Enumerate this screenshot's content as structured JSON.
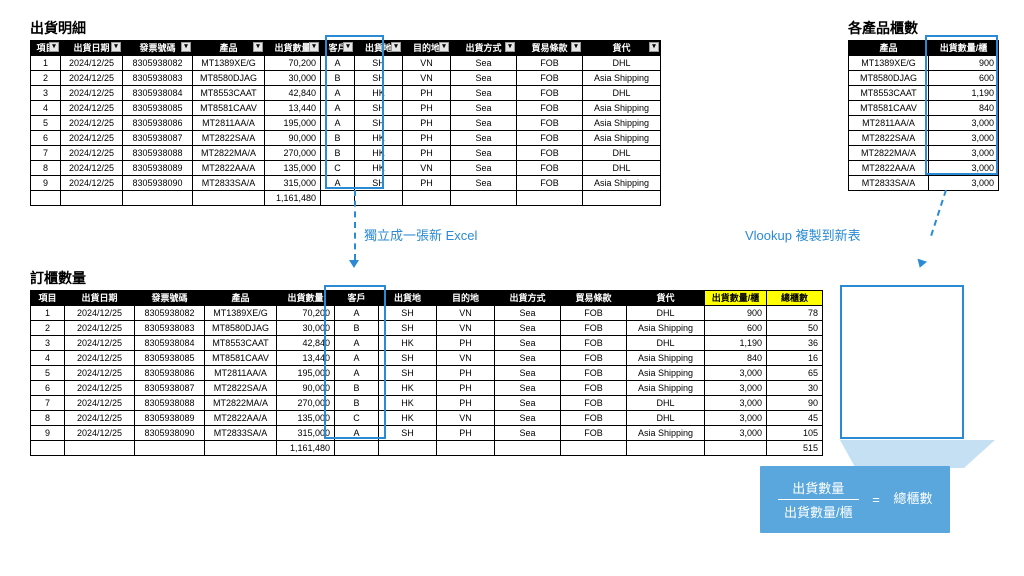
{
  "titles": {
    "detail": "出貨明細",
    "product_qty": "各產品櫃數",
    "order_qty": "訂櫃數量"
  },
  "detail_headers": {
    "idx": "項目",
    "date": "出貨日期",
    "inv": "發票號碼",
    "prod": "產品",
    "qty": "出貨數量",
    "cust": "客戶",
    "origin": "出貨地",
    "dest": "目的地",
    "mode": "出貨方式",
    "terms": "貿易條款",
    "forwarder": "貨代"
  },
  "product_headers": {
    "prod": "產品",
    "per": "出貨數量/櫃"
  },
  "order_headers": {
    "per": "出貨數量/櫃",
    "total": "總櫃數"
  },
  "detail_rows": [
    {
      "i": "1",
      "d": "2024/12/25",
      "inv": "8305938082",
      "p": "MT1389XE/G",
      "q": "70,200",
      "c": "A",
      "o": "SH",
      "de": "VN",
      "m": "Sea",
      "t": "FOB",
      "f": "DHL"
    },
    {
      "i": "2",
      "d": "2024/12/25",
      "inv": "8305938083",
      "p": "MT8580DJAG",
      "q": "30,000",
      "c": "B",
      "o": "SH",
      "de": "VN",
      "m": "Sea",
      "t": "FOB",
      "f": "Asia Shipping"
    },
    {
      "i": "3",
      "d": "2024/12/25",
      "inv": "8305938084",
      "p": "MT8553CAAT",
      "q": "42,840",
      "c": "A",
      "o": "HK",
      "de": "PH",
      "m": "Sea",
      "t": "FOB",
      "f": "DHL"
    },
    {
      "i": "4",
      "d": "2024/12/25",
      "inv": "8305938085",
      "p": "MT8581CAAV",
      "q": "13,440",
      "c": "A",
      "o": "SH",
      "de": "PH",
      "m": "Sea",
      "t": "FOB",
      "f": "Asia Shipping"
    },
    {
      "i": "5",
      "d": "2024/12/25",
      "inv": "8305938086",
      "p": "MT2811AA/A",
      "q": "195,000",
      "c": "A",
      "o": "SH",
      "de": "PH",
      "m": "Sea",
      "t": "FOB",
      "f": "Asia Shipping"
    },
    {
      "i": "6",
      "d": "2024/12/25",
      "inv": "8305938087",
      "p": "MT2822SA/A",
      "q": "90,000",
      "c": "B",
      "o": "HK",
      "de": "PH",
      "m": "Sea",
      "t": "FOB",
      "f": "Asia Shipping"
    },
    {
      "i": "7",
      "d": "2024/12/25",
      "inv": "8305938088",
      "p": "MT2822MA/A",
      "q": "270,000",
      "c": "B",
      "o": "HK",
      "de": "PH",
      "m": "Sea",
      "t": "FOB",
      "f": "DHL"
    },
    {
      "i": "8",
      "d": "2024/12/25",
      "inv": "8305938089",
      "p": "MT2822AA/A",
      "q": "135,000",
      "c": "C",
      "o": "HK",
      "de": "VN",
      "m": "Sea",
      "t": "FOB",
      "f": "DHL"
    },
    {
      "i": "9",
      "d": "2024/12/25",
      "inv": "8305938090",
      "p": "MT2833SA/A",
      "q": "315,000",
      "c": "A",
      "o": "SH",
      "de": "PH",
      "m": "Sea",
      "t": "FOB",
      "f": "Asia Shipping"
    }
  ],
  "detail_total": "1,161,480",
  "product_rows": [
    {
      "p": "MT1389XE/G",
      "v": "900"
    },
    {
      "p": "MT8580DJAG",
      "v": "600"
    },
    {
      "p": "MT8553CAAT",
      "v": "1,190"
    },
    {
      "p": "MT8581CAAV",
      "v": "840"
    },
    {
      "p": "MT2811AA/A",
      "v": "3,000"
    },
    {
      "p": "MT2822SA/A",
      "v": "3,000"
    },
    {
      "p": "MT2822MA/A",
      "v": "3,000"
    },
    {
      "p": "MT2822AA/A",
      "v": "3,000"
    },
    {
      "p": "MT2833SA/A",
      "v": "3,000"
    }
  ],
  "order_rows": [
    {
      "i": "1",
      "d": "2024/12/25",
      "inv": "8305938082",
      "p": "MT1389XE/G",
      "q": "70,200",
      "c": "A",
      "o": "SH",
      "de": "VN",
      "m": "Sea",
      "t": "FOB",
      "f": "DHL",
      "per": "900",
      "tot": "78"
    },
    {
      "i": "2",
      "d": "2024/12/25",
      "inv": "8305938083",
      "p": "MT8580DJAG",
      "q": "30,000",
      "c": "B",
      "o": "SH",
      "de": "VN",
      "m": "Sea",
      "t": "FOB",
      "f": "Asia Shipping",
      "per": "600",
      "tot": "50"
    },
    {
      "i": "3",
      "d": "2024/12/25",
      "inv": "8305938084",
      "p": "MT8553CAAT",
      "q": "42,840",
      "c": "A",
      "o": "HK",
      "de": "PH",
      "m": "Sea",
      "t": "FOB",
      "f": "DHL",
      "per": "1,190",
      "tot": "36"
    },
    {
      "i": "4",
      "d": "2024/12/25",
      "inv": "8305938085",
      "p": "MT8581CAAV",
      "q": "13,440",
      "c": "A",
      "o": "SH",
      "de": "VN",
      "m": "Sea",
      "t": "FOB",
      "f": "Asia Shipping",
      "per": "840",
      "tot": "16"
    },
    {
      "i": "5",
      "d": "2024/12/25",
      "inv": "8305938086",
      "p": "MT2811AA/A",
      "q": "195,000",
      "c": "A",
      "o": "SH",
      "de": "PH",
      "m": "Sea",
      "t": "FOB",
      "f": "Asia Shipping",
      "per": "3,000",
      "tot": "65"
    },
    {
      "i": "6",
      "d": "2024/12/25",
      "inv": "8305938087",
      "p": "MT2822SA/A",
      "q": "90,000",
      "c": "B",
      "o": "HK",
      "de": "PH",
      "m": "Sea",
      "t": "FOB",
      "f": "Asia Shipping",
      "per": "3,000",
      "tot": "30"
    },
    {
      "i": "7",
      "d": "2024/12/25",
      "inv": "8305938088",
      "p": "MT2822MA/A",
      "q": "270,000",
      "c": "B",
      "o": "HK",
      "de": "PH",
      "m": "Sea",
      "t": "FOB",
      "f": "DHL",
      "per": "3,000",
      "tot": "90"
    },
    {
      "i": "8",
      "d": "2024/12/25",
      "inv": "8305938089",
      "p": "MT2822AA/A",
      "q": "135,000",
      "c": "C",
      "o": "HK",
      "de": "VN",
      "m": "Sea",
      "t": "FOB",
      "f": "DHL",
      "per": "3,000",
      "tot": "45"
    },
    {
      "i": "9",
      "d": "2024/12/25",
      "inv": "8305938090",
      "p": "MT2833SA/A",
      "q": "315,000",
      "c": "A",
      "o": "SH",
      "de": "PH",
      "m": "Sea",
      "t": "FOB",
      "f": "Asia Shipping",
      "per": "3,000",
      "tot": "105"
    }
  ],
  "order_total_qty": "1,161,480",
  "order_total_cab": "515",
  "annotations": {
    "new_excel": "獨立成一張新 Excel",
    "vlookup": "Vlookup 複製到新表"
  },
  "formula": {
    "num": "出貨數量",
    "den": "出貨數量/櫃",
    "eq": "=",
    "res": "總櫃數"
  }
}
